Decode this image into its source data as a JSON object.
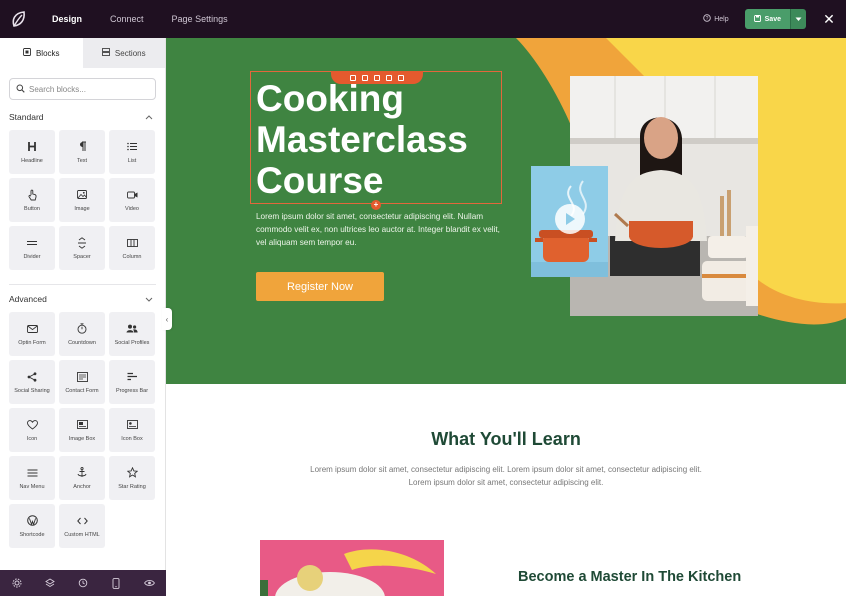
{
  "topbar": {
    "tabs": [
      "Design",
      "Connect",
      "Page Settings"
    ],
    "help_label": "Help",
    "save_label": "Save"
  },
  "sidebar": {
    "tabs": [
      "Blocks",
      "Sections"
    ],
    "search_placeholder": "Search blocks...",
    "standard": {
      "heading": "Standard",
      "blocks": [
        {
          "label": "Headline",
          "icon": "headline-icon"
        },
        {
          "label": "Text",
          "icon": "pilcrow-icon"
        },
        {
          "label": "List",
          "icon": "list-icon"
        },
        {
          "label": "Button",
          "icon": "pointer-hand-icon"
        },
        {
          "label": "Image",
          "icon": "image-icon"
        },
        {
          "label": "Video",
          "icon": "video-camera-icon"
        },
        {
          "label": "Divider",
          "icon": "divider-icon"
        },
        {
          "label": "Spacer",
          "icon": "spacer-icon"
        },
        {
          "label": "Column",
          "icon": "columns-icon"
        }
      ]
    },
    "advanced": {
      "heading": "Advanced",
      "blocks": [
        {
          "label": "Optin Form",
          "icon": "envelope-icon"
        },
        {
          "label": "Countdown",
          "icon": "stopwatch-icon"
        },
        {
          "label": "Social Profiles",
          "icon": "users-icon"
        },
        {
          "label": "Social Sharing",
          "icon": "share-icon"
        },
        {
          "label": "Contact Form",
          "icon": "form-icon"
        },
        {
          "label": "Progress Bar",
          "icon": "progress-bar-icon"
        },
        {
          "label": "Icon",
          "icon": "heart-icon"
        },
        {
          "label": "Image Box",
          "icon": "image-box-icon"
        },
        {
          "label": "Icon Box",
          "icon": "icon-box-icon"
        },
        {
          "label": "Nav Menu",
          "icon": "menu-icon"
        },
        {
          "label": "Anchor",
          "icon": "anchor-icon"
        },
        {
          "label": "Star Rating",
          "icon": "star-icon"
        },
        {
          "label": "Shortcode",
          "icon": "wordpress-icon"
        },
        {
          "label": "Custom HTML",
          "icon": "code-icon"
        }
      ]
    }
  },
  "hero": {
    "title": "Cooking Masterclass Course",
    "body": "Lorem ipsum dolor sit amet, consectetur adipiscing elit. Nullam commodo velit ex, non ultrices leo auctor at. Integer blandit ex velit, vel aliquam sem tempor eu.",
    "button_label": "Register Now"
  },
  "learn": {
    "title": "What You'll Learn",
    "body": "Lorem ipsum dolor sit amet, consectetur adipiscing elit. Lorem ipsum dolor sit amet, consectetur adipiscing elit. Lorem ipsum dolor sit amet, consectetur adipiscing elit."
  },
  "master": {
    "title": "Become a Master In The Kitchen"
  },
  "colors": {
    "hero_green": "#3f8441",
    "hero_orange": "#f0a43b",
    "hero_yellow": "#f9d649",
    "accent_red": "#e45a2e",
    "heading_green": "#1f4a36",
    "save_green": "#4a9d6a"
  }
}
